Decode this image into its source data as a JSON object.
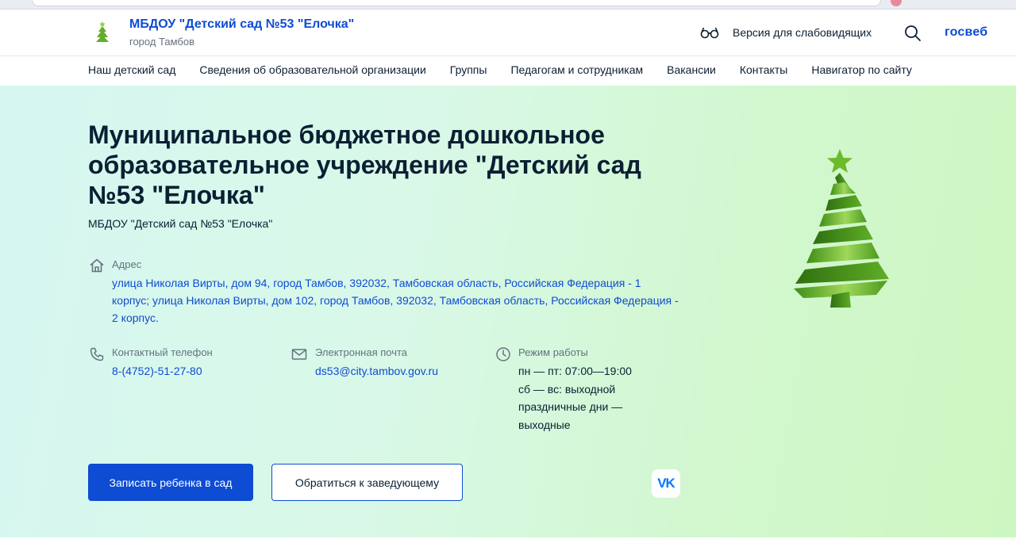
{
  "header": {
    "site_name": "МБДОУ \"Детский сад №53 \"Елочка\"",
    "city": "город Тамбов",
    "accessibility_label": "Версия для слабовидящих",
    "gosweb_label": "госвеб"
  },
  "nav": {
    "items": [
      "Наш детский сад",
      "Сведения об образовательной организации",
      "Группы",
      "Педагогам и сотрудникам",
      "Вакансии",
      "Контакты",
      "Навигатор по сайту"
    ]
  },
  "hero": {
    "title": "Муниципальное бюджетное дошкольное образовательное учреждение \"Детский сад №53 \"Елочка\"",
    "subtitle": "МБДОУ \"Детский сад №53 \"Елочка\"",
    "address": {
      "label": "Адрес",
      "value": "улица Николая Вирты, дом 94, город Тамбов, 392032, Тамбовская область, Российская Федерация - 1 корпус; улица Николая Вирты, дом 102, город Тамбов, 392032, Тамбовская область, Российская Федерация - 2 корпус."
    },
    "phone": {
      "label": "Контактный телефон",
      "value": "8-(4752)-51-27-80"
    },
    "email": {
      "label": "Электронная почта",
      "value": "ds53@city.tambov.gov.ru"
    },
    "hours": {
      "label": "Режим работы",
      "lines": [
        "пн — пт: 07:00—19:00",
        "сб — вс: выходной",
        "праздничные дни —",
        "выходные"
      ]
    },
    "primary_button": "Записать ребенка в сад",
    "secondary_button": "Обратиться к заведующему",
    "social_vk_label": "VK"
  },
  "colors": {
    "brand_blue": "#0d4cd3",
    "text_dark": "#0b1f33",
    "text_muted": "#66727f",
    "tree_green": "#5aa51e"
  },
  "icons": [
    "tree-logo-icon",
    "glasses-icon",
    "search-icon",
    "home-icon",
    "phone-icon",
    "mail-icon",
    "clock-icon",
    "vk-icon",
    "christmas-tree-icon"
  ]
}
